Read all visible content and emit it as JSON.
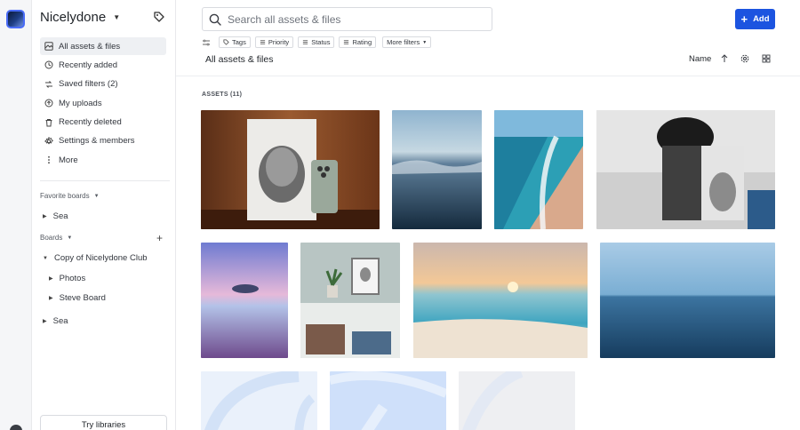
{
  "workspace": {
    "name": "Nicelydone"
  },
  "sidebar": {
    "nav": [
      {
        "label": "All assets & files",
        "icon": "assets-icon",
        "active": true
      },
      {
        "label": "Recently added",
        "icon": "clock-icon"
      },
      {
        "label": "Saved filters (2)",
        "icon": "saved-filters-icon"
      },
      {
        "label": "My uploads",
        "icon": "uploads-icon"
      },
      {
        "label": "Recently deleted",
        "icon": "trash-icon"
      },
      {
        "label": "Settings & members",
        "icon": "gear-icon"
      },
      {
        "label": "More",
        "icon": "more-vertical-icon"
      }
    ],
    "favorite_boards_label": "Favorite boards",
    "favorite_boards": [
      {
        "label": "Sea"
      }
    ],
    "boards_label": "Boards",
    "boards": {
      "parent": "Copy of Nicelydone Club",
      "children": [
        "Photos",
        "Steve Board"
      ],
      "other": "Sea"
    },
    "try_libraries_label": "Try libraries"
  },
  "header": {
    "search_placeholder": "Search all assets & files",
    "add_label": "Add",
    "filters": [
      "Tags",
      "Priority",
      "Status",
      "Rating",
      "More filters"
    ],
    "title": "All assets & files",
    "sort_label": "Name"
  },
  "content": {
    "assets_label": "ASSETS (11)"
  },
  "colors": {
    "accent": "#1c54e0",
    "active_nav_bg": "#eef0f3"
  }
}
